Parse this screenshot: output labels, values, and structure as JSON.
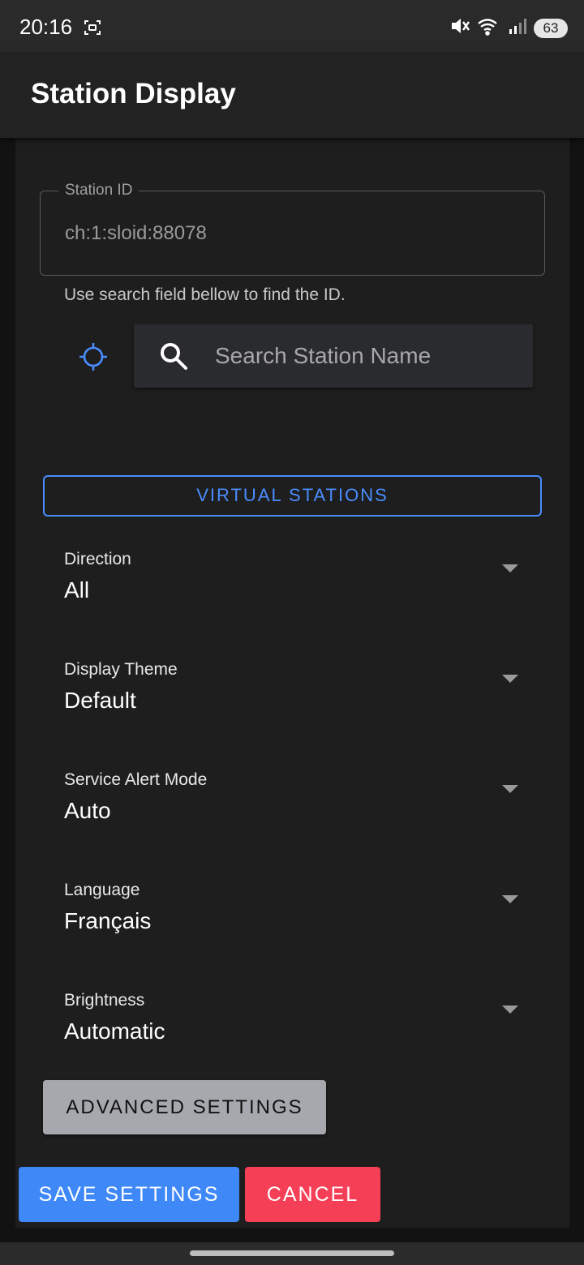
{
  "status_bar": {
    "time": "20:16",
    "battery": "63",
    "icons": [
      "screenshot-icon",
      "mute-icon",
      "wifi-icon",
      "signal-icon",
      "battery-icon"
    ]
  },
  "app_bar": {
    "title": "Station Display"
  },
  "station_field": {
    "label": "Station ID",
    "value": "ch:1:sloid:88078",
    "helper": "Use search field bellow to find the ID."
  },
  "search": {
    "placeholder": "Search Station Name",
    "value": ""
  },
  "virtual_stations_label": "VIRTUAL STATIONS",
  "settings": [
    {
      "label": "Direction",
      "value": "All"
    },
    {
      "label": "Display Theme",
      "value": "Default"
    },
    {
      "label": "Service Alert Mode",
      "value": "Auto"
    },
    {
      "label": "Language",
      "value": "Français"
    },
    {
      "label": "Brightness",
      "value": "Automatic"
    }
  ],
  "advanced_label": "ADVANCED SETTINGS",
  "save_label": "SAVE SETTINGS",
  "cancel_label": "CANCEL",
  "colors": {
    "accent": "#4a8dff",
    "save": "#3f88f8",
    "cancel": "#f53f57",
    "card": "#1e1e1e"
  }
}
